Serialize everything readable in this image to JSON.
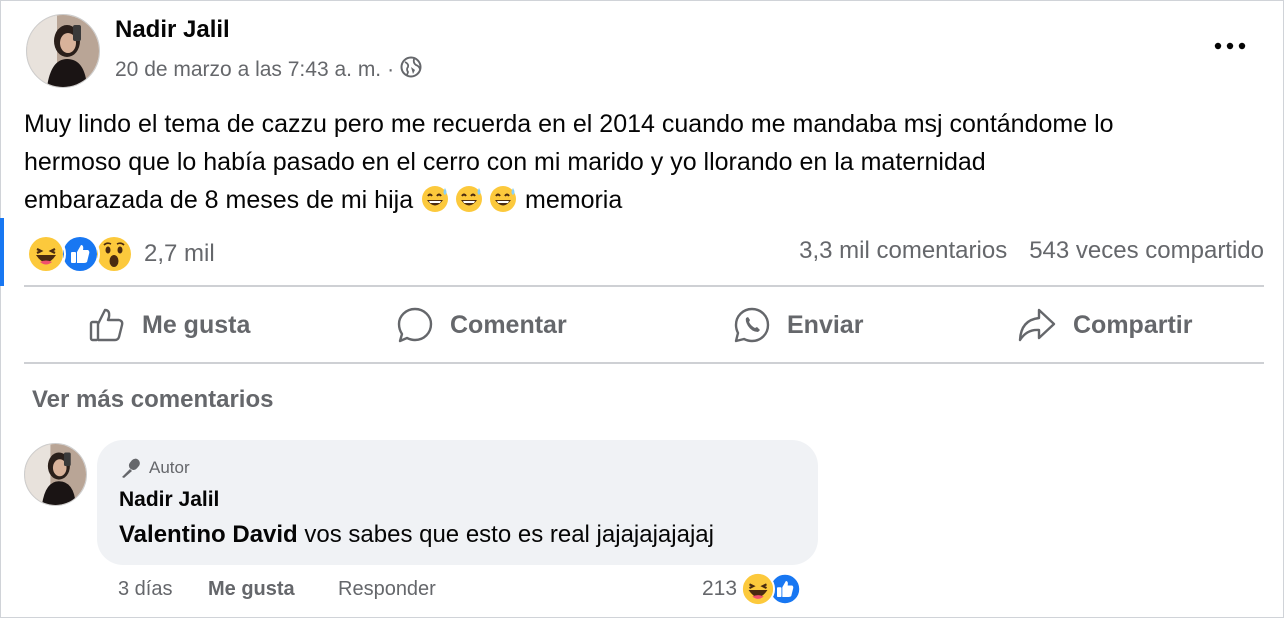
{
  "post": {
    "author": "Nadir Jalil",
    "date": "20 de marzo a las 7:43 a. m.",
    "separator": "·",
    "privacy_icon": "globe-icon",
    "text_lines": [
      "Muy lindo el tema de cazzu pero me recuerda en el 2014 cuando me mandaba msj contándome lo",
      "hermoso que lo había pasado en el cerro con mi marido y yo llorando en la maternidad",
      "embarazada de 8 meses de mi hija"
    ],
    "text_tail": "memoria",
    "emoji": "grinning-sweat-emoji"
  },
  "reactions": {
    "icons": [
      "haha-icon",
      "like-icon",
      "wow-icon"
    ],
    "count": "2,7 mil",
    "comments": "3,3 mil comentarios",
    "shares": "543 veces compartido"
  },
  "actions": {
    "like": "Me gusta",
    "comment": "Comentar",
    "send": "Enviar",
    "share": "Compartir"
  },
  "comments_section": {
    "more_label": "Ver más comentarios",
    "comment": {
      "badge": "Autor",
      "author": "Nadir Jalil",
      "mention": "Valentino David",
      "text": " vos sabes que esto es real jajajajajajaj",
      "time": "3 días",
      "like_label": "Me gusta",
      "reply_label": "Responder",
      "reaction_count": "213",
      "reaction_icons": [
        "haha-icon",
        "like-icon"
      ]
    }
  },
  "colors": {
    "like_blue": "#1877f2",
    "reaction_yellow": "#fcc93c",
    "secondary_text": "#65676b",
    "bubble_bg": "#f0f2f5"
  }
}
